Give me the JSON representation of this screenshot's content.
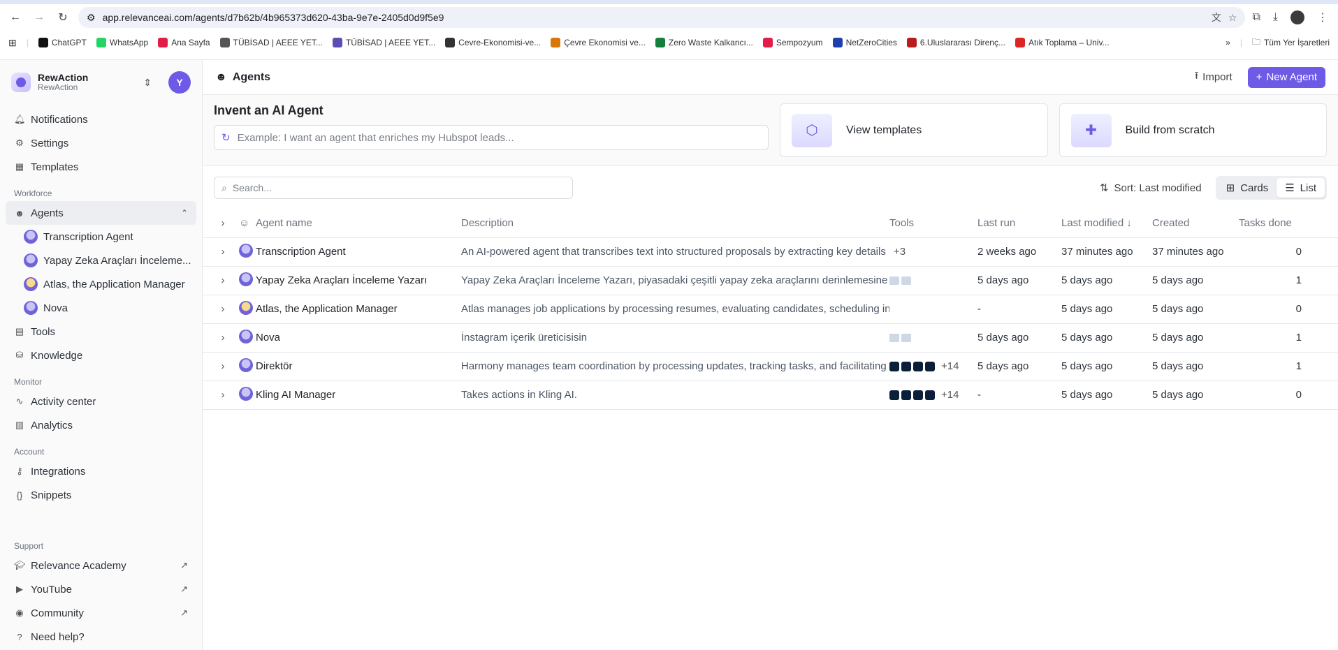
{
  "browser": {
    "url": "app.relevanceai.com/agents/d7b62b/4b965373d620-43ba-9e7e-2405d0d9f5e9",
    "bookmarks": [
      {
        "label": "ChatGPT",
        "color": "#111111"
      },
      {
        "label": "WhatsApp",
        "color": "#25d366"
      },
      {
        "label": "Ana Sayfa",
        "color": "#e11d48"
      },
      {
        "label": "TÜBİSAD | AEEE YET...",
        "color": "#555555"
      },
      {
        "label": "TÜBİSAD | AEEE YET...",
        "color": "#5b4fb3"
      },
      {
        "label": "Cevre-Ekonomisi-ve...",
        "color": "#333333"
      },
      {
        "label": "Çevre Ekonomisi ve...",
        "color": "#d97706"
      },
      {
        "label": "Zero Waste Kalkancı...",
        "color": "#15803d"
      },
      {
        "label": "Sempozyum",
        "color": "#e11d48"
      },
      {
        "label": "NetZeroCities",
        "color": "#1e40af"
      },
      {
        "label": "6.Uluslararası Direnç...",
        "color": "#b91c1c"
      },
      {
        "label": "Atık Toplama – Univ...",
        "color": "#dc2626"
      }
    ],
    "bookmarks_folder": "Tüm Yer İşaretleri"
  },
  "org": {
    "name": "RewAction",
    "sub": "RewAction",
    "avatar": "Y"
  },
  "sidebar": {
    "top": [
      {
        "label": "Notifications",
        "icon": "bell-icon"
      },
      {
        "label": "Settings",
        "icon": "gear-icon"
      },
      {
        "label": "Templates",
        "icon": "calendar-icon"
      }
    ],
    "workforce_label": "Workforce",
    "agents_label": "Agents",
    "agents": [
      "Transcription Agent",
      "Yapay Zeka Araçları İnceleme...",
      "Atlas, the Application Manager",
      "Nova"
    ],
    "tools_label": "Tools",
    "knowledge_label": "Knowledge",
    "monitor_label": "Monitor",
    "activity_label": "Activity center",
    "analytics_label": "Analytics",
    "account_label": "Account",
    "integrations_label": "Integrations",
    "snippets_label": "Snippets",
    "support_label": "Support",
    "academy_label": "Relevance Academy",
    "youtube_label": "YouTube",
    "community_label": "Community",
    "help_label": "Need help?"
  },
  "header": {
    "title": "Agents",
    "import_label": "Import",
    "new_label": "New Agent"
  },
  "invent": {
    "title": "Invent an AI Agent",
    "placeholder": "Example: I want an agent that enriches my Hubspot leads...",
    "templates_label": "View templates",
    "scratch_label": "Build from scratch"
  },
  "toolbar": {
    "search_placeholder": "Search...",
    "sort_label": "Sort: Last modified",
    "cards_label": "Cards",
    "list_label": "List"
  },
  "table": {
    "headers": {
      "name": "Agent name",
      "description": "Description",
      "tools": "Tools",
      "last_run": "Last run",
      "last_modified": "Last modified",
      "created": "Created",
      "tasks": "Tasks done"
    },
    "rows": [
      {
        "name": "Transcription Agent",
        "description": "An AI-powered agent that transcribes text into structured proposals by extracting key details",
        "tools_extra": "+3",
        "tool_squares": 0,
        "tool_mini": 0,
        "last_run": "2 weeks ago",
        "last_modified": "37 minutes ago",
        "created": "37 minutes ago",
        "tasks": "0",
        "gold": false
      },
      {
        "name": "Yapay Zeka Araçları İnceleme Yazarı",
        "description": "Yapay Zeka Araçları İnceleme Yazarı, piyasadaki çeşitli yapay zeka araçlarını derinlemesine",
        "tools_extra": "",
        "tool_squares": 0,
        "tool_mini": 2,
        "last_run": "5 days ago",
        "last_modified": "5 days ago",
        "created": "5 days ago",
        "tasks": "1",
        "gold": false
      },
      {
        "name": "Atlas, the Application Manager",
        "description": "Atlas manages job applications by processing resumes, evaluating candidates, scheduling interviews",
        "tools_extra": "",
        "tool_squares": 0,
        "tool_mini": 0,
        "last_run": "-",
        "last_modified": "5 days ago",
        "created": "5 days ago",
        "tasks": "0",
        "gold": true
      },
      {
        "name": "Nova",
        "description": "İnstagram içerik üreticisisin",
        "tools_extra": "",
        "tool_squares": 0,
        "tool_mini": 2,
        "last_run": "5 days ago",
        "last_modified": "5 days ago",
        "created": "5 days ago",
        "tasks": "1",
        "gold": false
      },
      {
        "name": "Direktör",
        "description": "Harmony manages team coordination by processing updates, tracking tasks, and facilitating",
        "tools_extra": "+14",
        "tool_squares": 4,
        "tool_mini": 0,
        "last_run": "5 days ago",
        "last_modified": "5 days ago",
        "created": "5 days ago",
        "tasks": "1",
        "gold": false
      },
      {
        "name": "Kling AI Manager",
        "description": "Takes actions in Kling AI.",
        "tools_extra": "+14",
        "tool_squares": 4,
        "tool_mini": 0,
        "last_run": "-",
        "last_modified": "5 days ago",
        "created": "5 days ago",
        "tasks": "0",
        "gold": false
      }
    ]
  },
  "colors": {
    "accent": "#6d5ae6"
  }
}
